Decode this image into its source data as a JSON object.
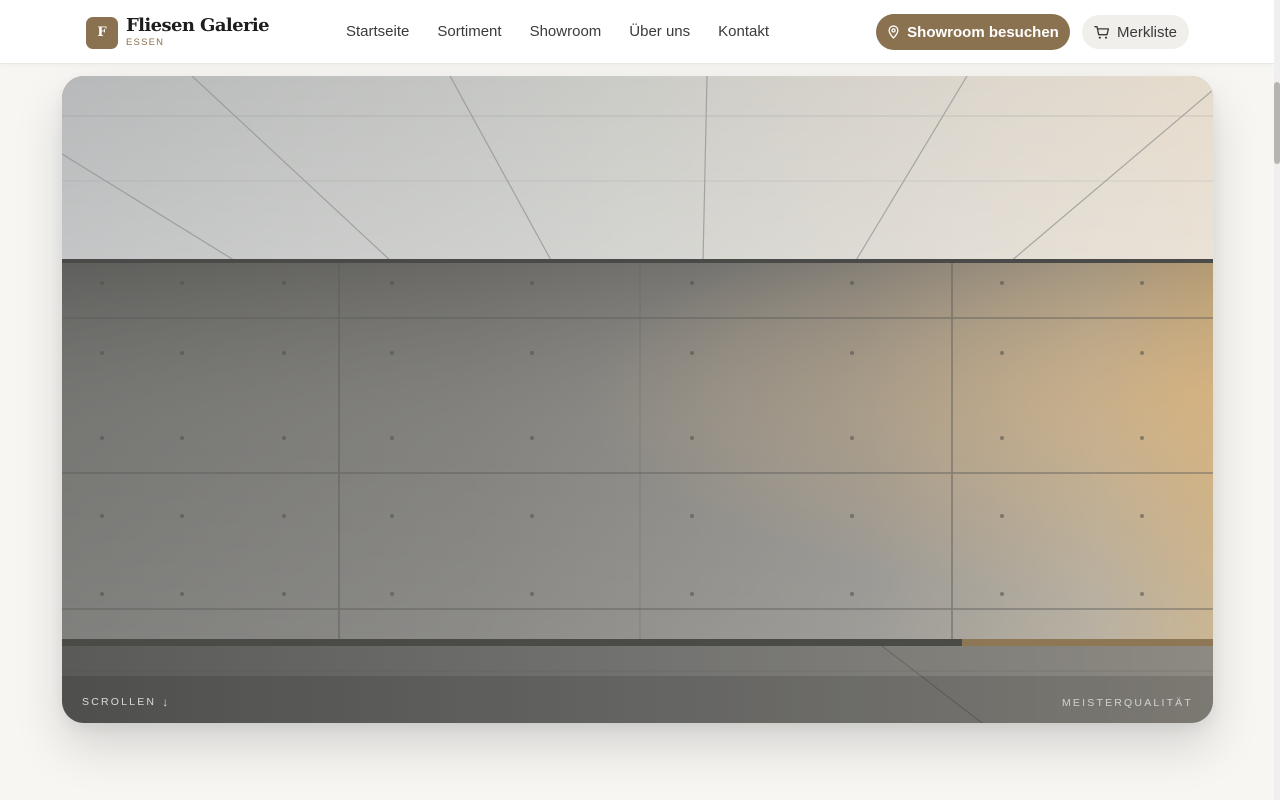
{
  "brand": {
    "mark": "F",
    "title": "Fliesen Galerie",
    "subtitle": "ESSEN",
    "accent_color": "#8a7150"
  },
  "nav": {
    "items": [
      {
        "label": "Startseite"
      },
      {
        "label": "Sortiment"
      },
      {
        "label": "Showroom"
      },
      {
        "label": "Über uns"
      },
      {
        "label": "Kontakt"
      }
    ]
  },
  "actions": {
    "showroom_label": "Showroom besuchen",
    "showroom_icon": "map-pin-icon",
    "wishlist_label": "Merkliste",
    "wishlist_icon": "cart-icon"
  },
  "hero": {
    "scroll_label": "SCROLLEN",
    "scroll_icon": "arrow-down-icon",
    "quality_label": "MEISTERQUALITÄT"
  }
}
